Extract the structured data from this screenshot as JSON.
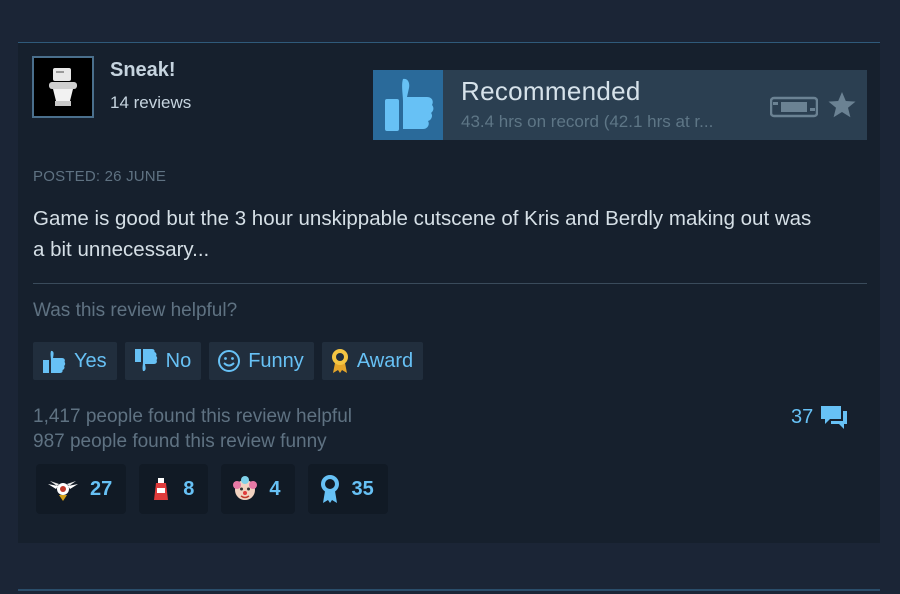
{
  "author": {
    "name": "Sneak!",
    "reviews": "14 reviews"
  },
  "verdict": {
    "label": "Recommended",
    "hours": "43.4 hrs on record (42.1 hrs at r..."
  },
  "posted": "POSTED: 26 JUNE",
  "review_text": "Game is good but the 3 hour unskippable cutscene of Kris and Berdly making out was a bit unnecessary...",
  "helpful_prompt": "Was this review helpful?",
  "vote_buttons": [
    {
      "label": "Yes",
      "icon": "thumbs-up-icon"
    },
    {
      "label": "No",
      "icon": "thumbs-down-icon"
    },
    {
      "label": "Funny",
      "icon": "smiley-icon"
    },
    {
      "label": "Award",
      "icon": "award-icon"
    }
  ],
  "stats": {
    "helpful": "1,417 people found this review helpful",
    "funny": "987 people found this review funny"
  },
  "comments": {
    "count": "37",
    "icon": "comment-icon"
  },
  "awards": [
    {
      "icon": "winged-award-icon",
      "count": "27"
    },
    {
      "icon": "hot-sauce-award-icon",
      "count": "8"
    },
    {
      "icon": "clown-award-icon",
      "count": "4"
    },
    {
      "icon": "ribbon-award-icon",
      "count": "35"
    }
  ],
  "colors": {
    "background": "#1b2536",
    "card": "#16202d",
    "accent": "#67c1f5",
    "thumb_box": "#2a6a9a",
    "muted": "#5f7282"
  }
}
